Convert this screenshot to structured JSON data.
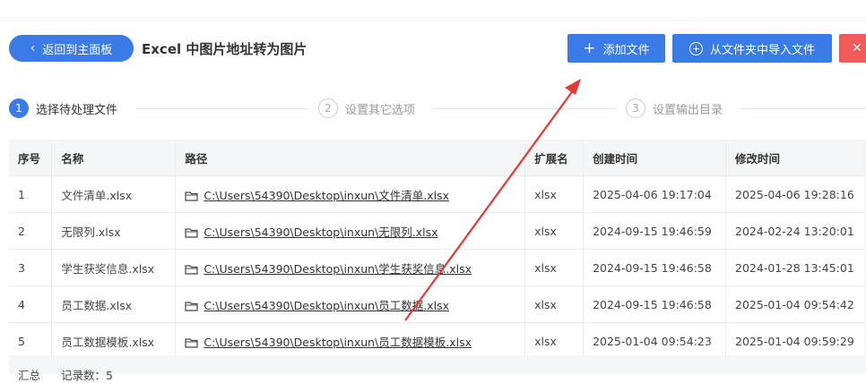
{
  "header": {
    "back_label": "返回到主面板",
    "title": "Excel 中图片地址转为图片",
    "add_label": "添加文件",
    "import_label": "从文件夹中导入文件",
    "close_glyph": "✕"
  },
  "steps": [
    {
      "num": "1",
      "label": "选择待处理文件"
    },
    {
      "num": "2",
      "label": "设置其它选项"
    },
    {
      "num": "3",
      "label": "设置输出目录"
    }
  ],
  "table": {
    "headers": [
      "序号",
      "名称",
      "路径",
      "扩展名",
      "创建时间",
      "修改时间"
    ],
    "rows": [
      [
        "1",
        "文件清单.xlsx",
        "C:\\Users\\54390\\Desktop\\inxun\\文件清单.xlsx",
        "xlsx",
        "2025-04-06 19:17:04",
        "2025-04-06 19:28:16"
      ],
      [
        "2",
        "无限列.xlsx",
        "C:\\Users\\54390\\Desktop\\inxun\\无限列.xlsx",
        "xlsx",
        "2024-09-15 19:46:59",
        "2024-02-24 13:20:01"
      ],
      [
        "3",
        "学生获奖信息.xlsx",
        "C:\\Users\\54390\\Desktop\\inxun\\学生获奖信息.xlsx",
        "xlsx",
        "2024-09-15 19:46:58",
        "2024-01-28 13:45:01"
      ],
      [
        "4",
        "员工数据.xlsx",
        "C:\\Users\\54390\\Desktop\\inxun\\员工数据.xlsx",
        "xlsx",
        "2024-09-15 19:46:58",
        "2025-01-04 09:54:42"
      ],
      [
        "5",
        "员工数据模板.xlsx",
        "C:\\Users\\54390\\Desktop\\inxun\\员工数据模板.xlsx",
        "xlsx",
        "2025-01-04 09:54:23",
        "2025-01-04 09:59:29"
      ]
    ]
  },
  "footer": {
    "summary_label": "汇总",
    "record_count": "记录数：5"
  },
  "colors": {
    "primary": "#3b7be8",
    "danger": "#f25a5a",
    "annotation_arrow": "#e53935"
  }
}
